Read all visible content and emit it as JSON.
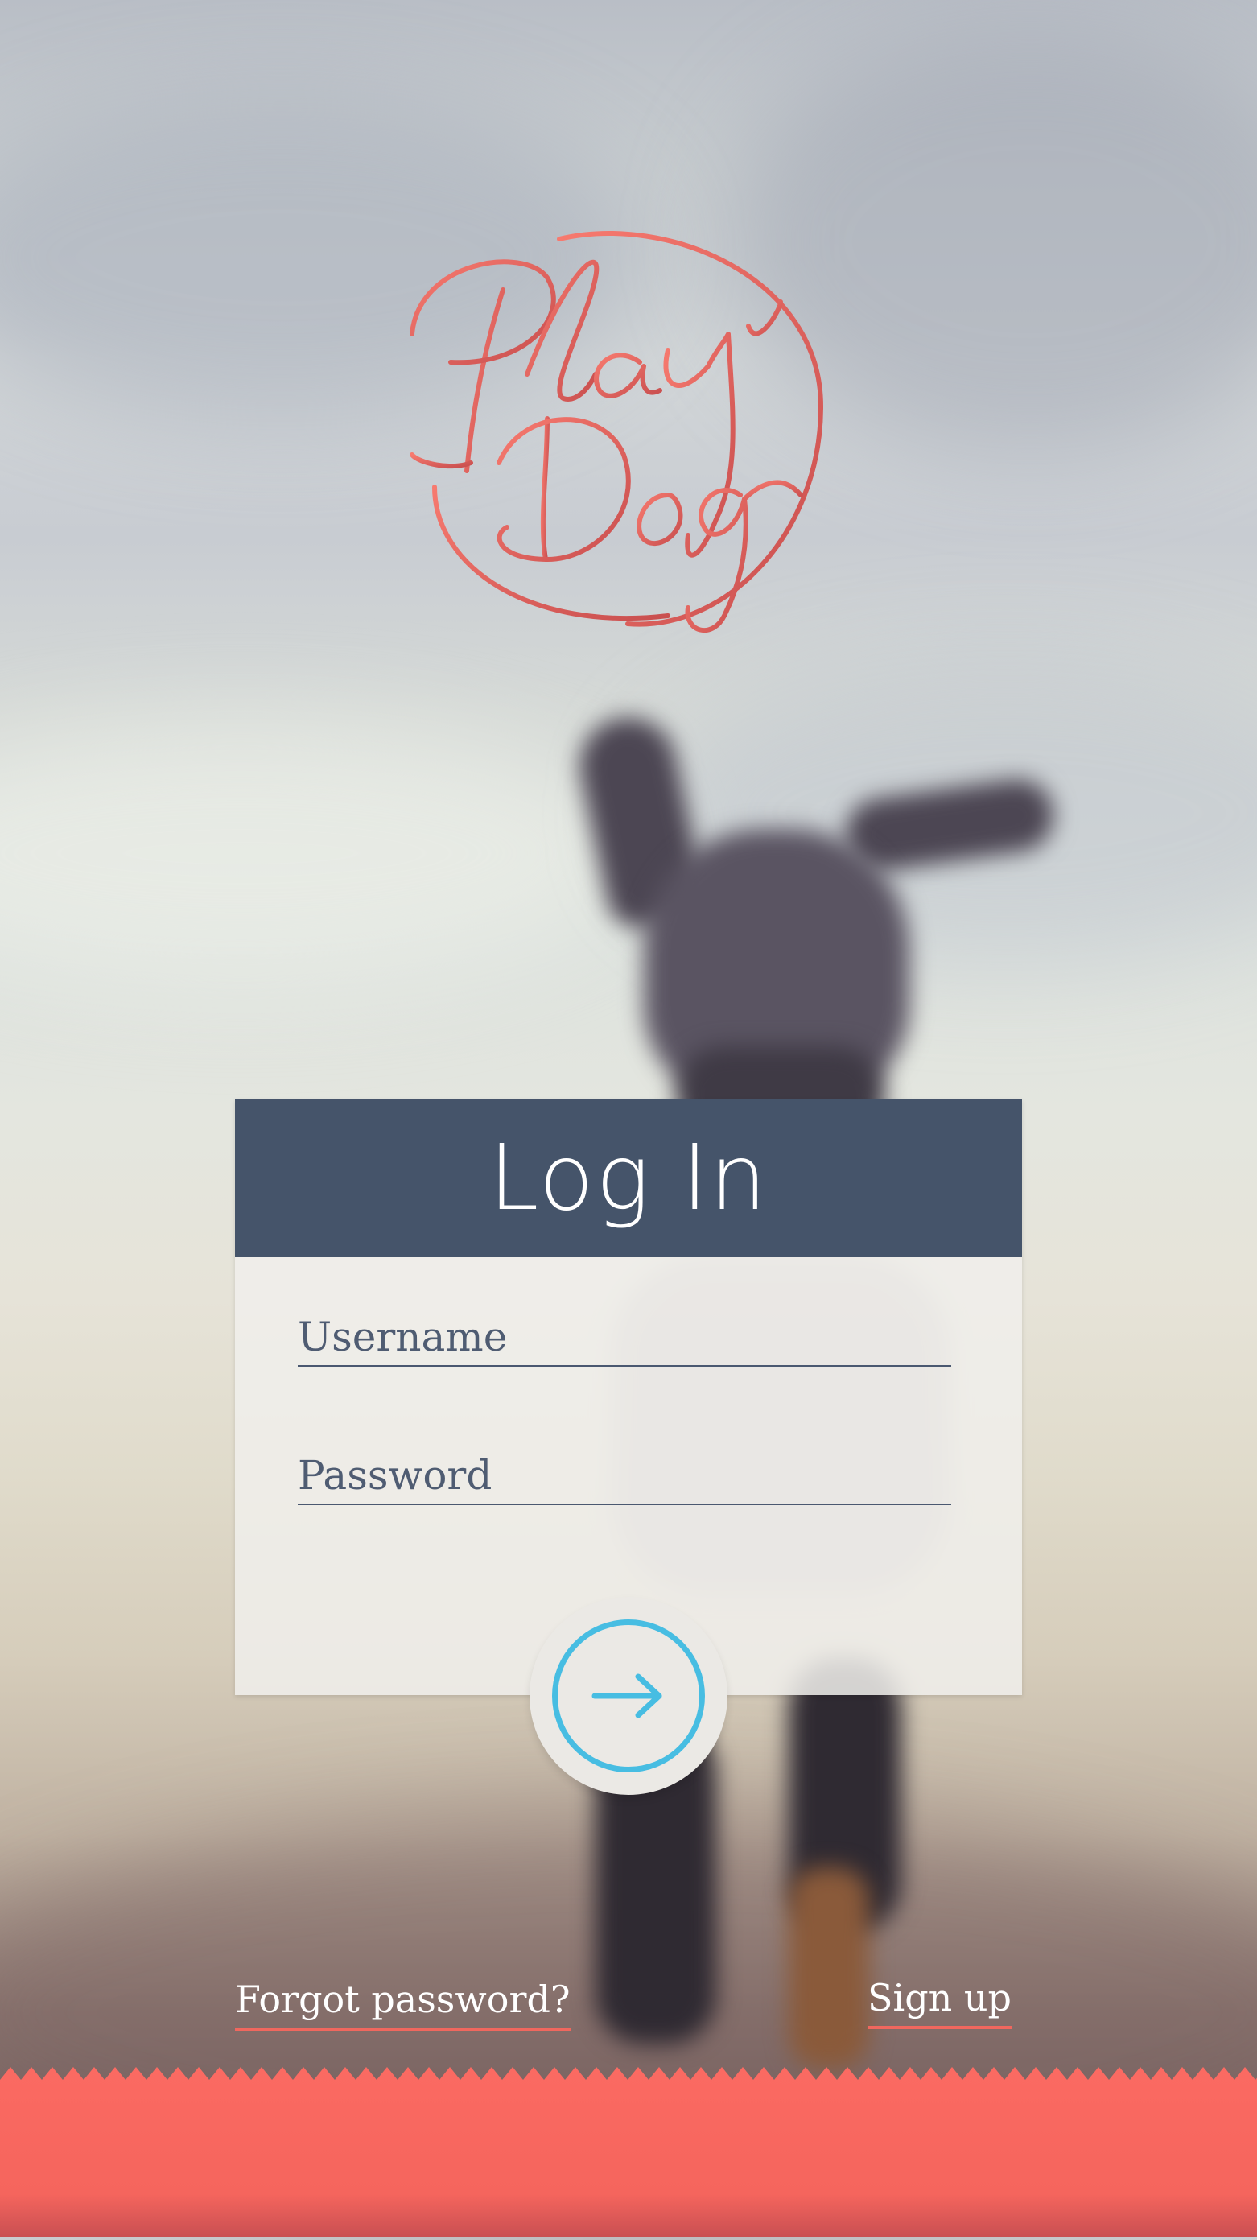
{
  "brand": {
    "logo_text": "Play Dog",
    "logo_color": "#f0675e"
  },
  "login": {
    "title": "Log In",
    "username_placeholder": "Username",
    "password_placeholder": "Password",
    "submit_icon": "arrow-right-icon"
  },
  "links": {
    "forgot_password": "Forgot password?",
    "sign_up": "Sign up"
  },
  "colors": {
    "header": "#45546a",
    "accent": "#f0675e",
    "button": "#47bde2"
  }
}
